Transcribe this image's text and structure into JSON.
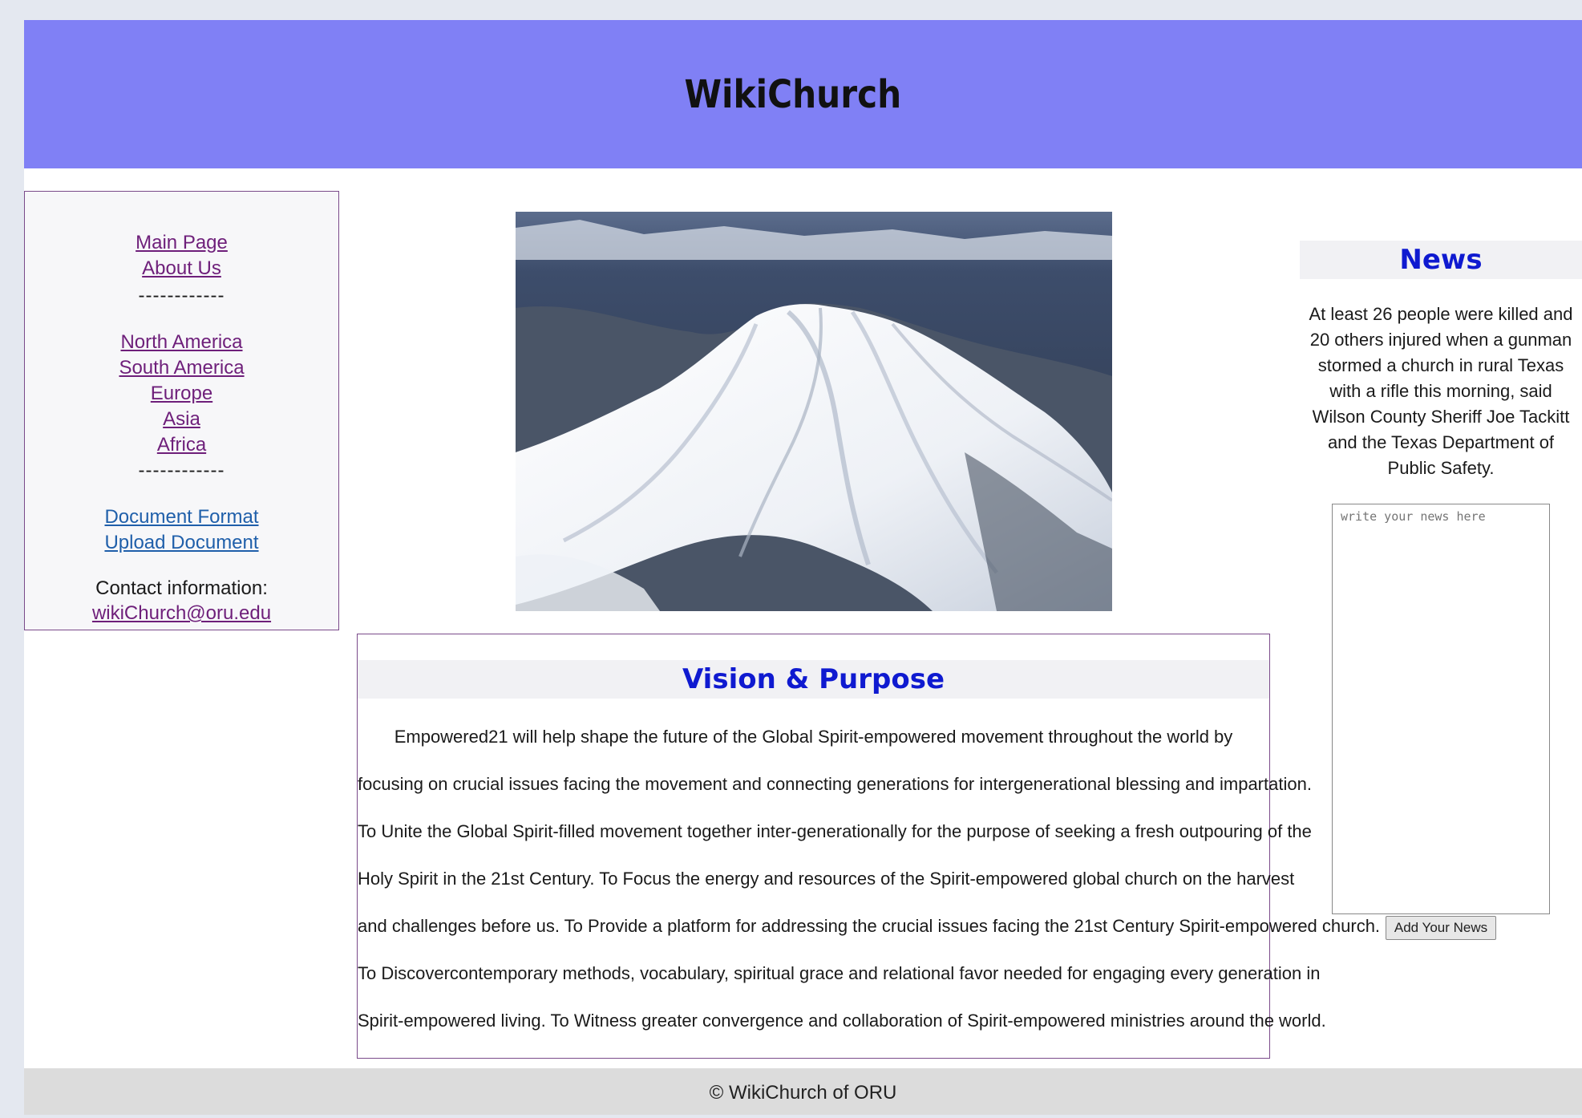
{
  "header": {
    "title": "WikiChurch"
  },
  "sidebar": {
    "nav_links": [
      "Main Page",
      "About Us"
    ],
    "separator": "------------",
    "region_links": [
      "North America",
      "South America",
      "Europe",
      "Asia",
      "Africa"
    ],
    "doc_links": [
      "Document Format",
      "Upload Document"
    ],
    "contact_label": "Contact information:",
    "contact_email": "wikiChurch@oru.edu"
  },
  "vision": {
    "title": "Vision & Purpose",
    "lines": [
      "Empowered21 will help shape the future of the Global Spirit-empowered movement throughout the world by",
      "focusing on crucial issues facing the movement and connecting generations for intergenerational blessing and impartation.",
      "To Unite the Global Spirit-filled movement together inter-generationally for the purpose of seeking a fresh outpouring of the",
      "Holy Spirit in the 21st Century. To Focus the energy and resources of the Spirit-empowered global church on the harvest",
      "and challenges before us. To Provide a platform for addressing the crucial issues facing the 21st Century Spirit-empowered church.",
      "To Discovercontemporary methods, vocabulary, spiritual grace and relational favor needed for engaging every generation in",
      "Spirit-empowered living. To Witness greater convergence and collaboration of Spirit-empowered ministries around the world."
    ]
  },
  "news": {
    "title": "News",
    "body": "At least 26 people were killed and 20 others injured when a gunman stormed a church in rural Texas with a rifle this morning, said Wilson County Sheriff Joe Tackitt and the Texas Department of Public Safety.",
    "textarea_placeholder": "write your news here",
    "button_label": "Add Your News"
  },
  "footer": {
    "text": "© WikiChurch of ORU"
  },
  "colors": {
    "header_bg": "#8080f5",
    "heading_blue": "#0f1ad0",
    "visited_link": "#6e1f7a",
    "link_blue": "#1f5faa"
  }
}
